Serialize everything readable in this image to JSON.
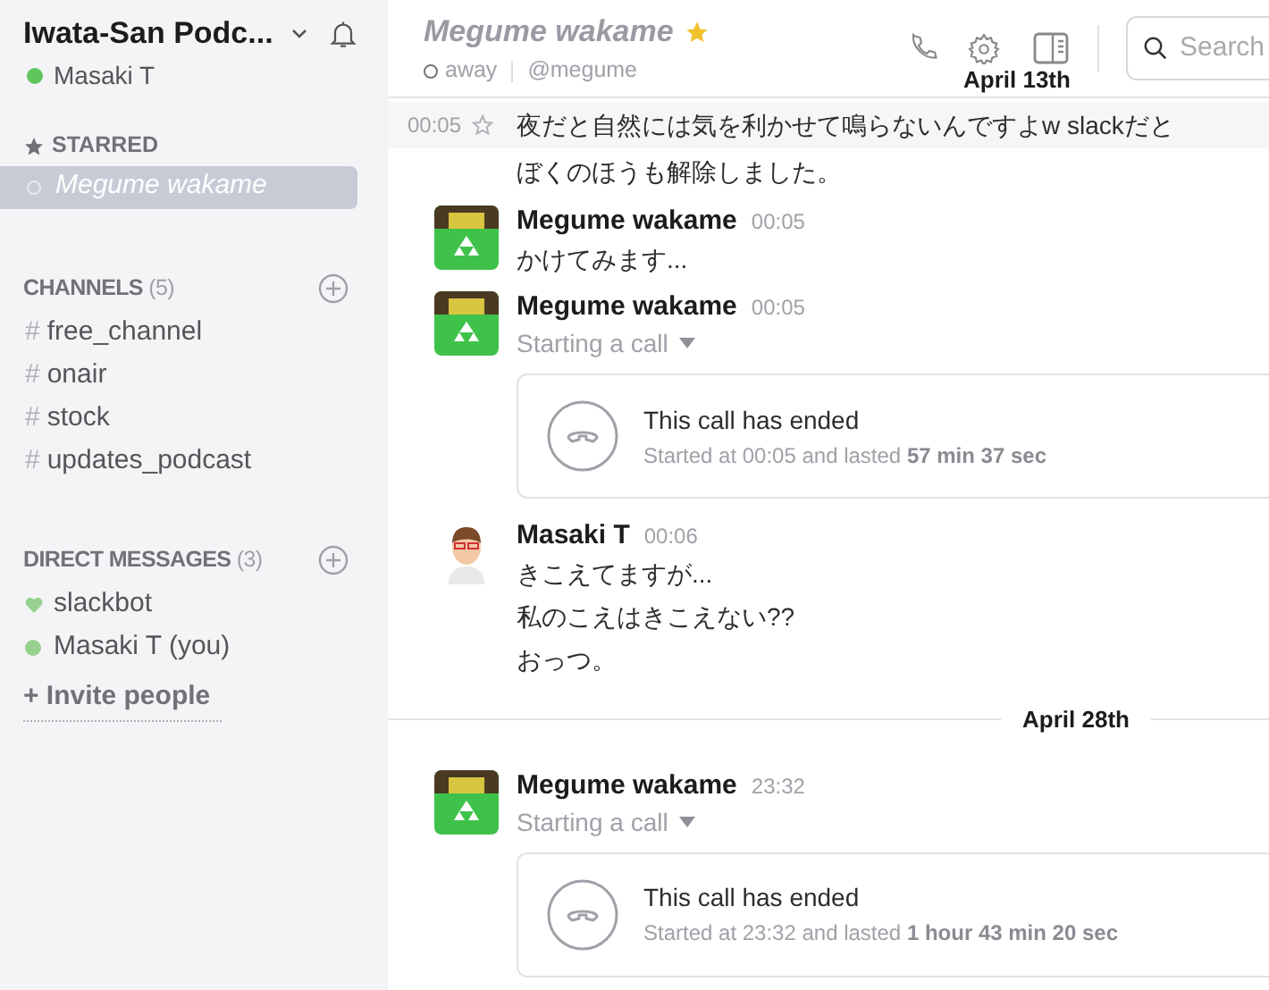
{
  "sidebar": {
    "team": "Iwata-San Podc...",
    "user": "Masaki T",
    "user_online": true,
    "starred": {
      "title": "STARRED",
      "items": [
        {
          "label": "Megume wakame",
          "selected": true
        }
      ]
    },
    "channels": {
      "title": "CHANNELS",
      "count": "(5)",
      "items": [
        {
          "prefix": "#",
          "label": "free_channel",
          "selected": false
        },
        {
          "prefix": "#",
          "label": "onair",
          "selected": false
        },
        {
          "prefix": "#",
          "label": "stock",
          "selected": false
        },
        {
          "prefix": "#",
          "label": "updates_podcast",
          "selected": false
        }
      ]
    },
    "direct_messages": {
      "title": "DIRECT MESSAGES",
      "count": "(3)",
      "items": [
        {
          "label": "slackbot",
          "kind": "heart",
          "selected": false
        },
        {
          "label": "Masaki T (you)",
          "kind": "dot",
          "selected": false
        }
      ]
    },
    "invite": "+ Invite people"
  },
  "header": {
    "title": "Megume wakame",
    "starred": true,
    "status": "away",
    "handle": "@megume",
    "search_placeholder": "Search"
  },
  "sticky_date": "April 13th",
  "messages": [
    {
      "kind": "continuation",
      "time": "00:05",
      "lines": [
        "夜だと自然には気を利かせて鳴らないんですよw slackだと",
        "ぼくのほうも解除しました。"
      ]
    },
    {
      "kind": "message",
      "avatar": {
        "kind": "recycle"
      },
      "name": "Megume wakame",
      "time": "00:05",
      "lines": [
        "かけてみます..."
      ]
    },
    {
      "kind": "call",
      "avatar": {
        "kind": "recycle"
      },
      "name": "Megume wakame",
      "time": "00:05",
      "subtitle": "Starting a call",
      "card_title": "This call has ended",
      "card_detail": "Started at 00:05 and lasted **57 min 37 sec**"
    },
    {
      "kind": "message",
      "avatar": {
        "kind": "person"
      },
      "name": "Masaki T",
      "time": "00:06",
      "lines": [
        "きこえてますが...",
        "私のこえはきこえない??",
        "おっつ。"
      ]
    },
    {
      "kind": "divider",
      "label": "April 28th"
    },
    {
      "kind": "call",
      "avatar": {
        "kind": "recycle"
      },
      "name": "Megume wakame",
      "time": "23:32",
      "subtitle": "Starting a call",
      "card_title": "This call has ended",
      "card_detail": "Started at 23:32 and lasted **1 hour 43 min 20 sec**"
    }
  ]
}
